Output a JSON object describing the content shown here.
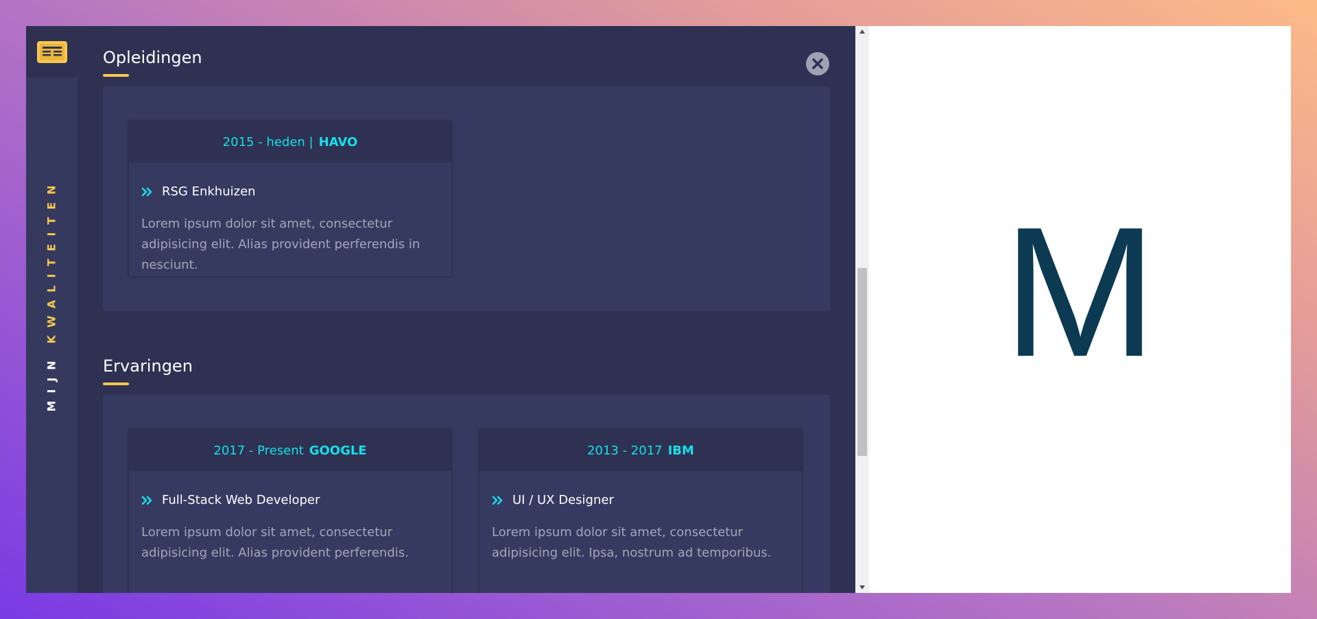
{
  "sidebar": {
    "icon": "newspaper-icon",
    "label_word1": "MIJN",
    "label_word2": "KWALITEITEN"
  },
  "sections": {
    "education": {
      "title": "Opleidingen",
      "cards": [
        {
          "period": "2015 - heden  |",
          "org": "HAVO",
          "title": "RSG Enkhuizen",
          "description": "Lorem ipsum dolor sit amet, consectetur adipisicing elit. Alias provident perferendis in nesciunt."
        }
      ]
    },
    "experience": {
      "title": "Ervaringen",
      "cards": [
        {
          "period": "2017 - Present",
          "org": "GOOGLE",
          "title": "Full-Stack Web Developer",
          "description": "Lorem ipsum dolor sit amet, consectetur adipisicing elit. Alias provident perferendis."
        },
        {
          "period": "2013 - 2017",
          "org": "IBM",
          "title": "UI / UX Designer",
          "description": "Lorem ipsum dolor sit amet, consectetur adipisicing elit. Ipsa, nostrum ad temporibus."
        }
      ]
    }
  },
  "close_icon": "close-icon",
  "preview": {
    "letter": "M"
  },
  "colors": {
    "panel_bg": "#2e3152",
    "card_bg": "#373a60",
    "accent_yellow": "#f9c74f",
    "accent_cyan": "#16e0ea",
    "preview_letter": "#0c3a53"
  }
}
